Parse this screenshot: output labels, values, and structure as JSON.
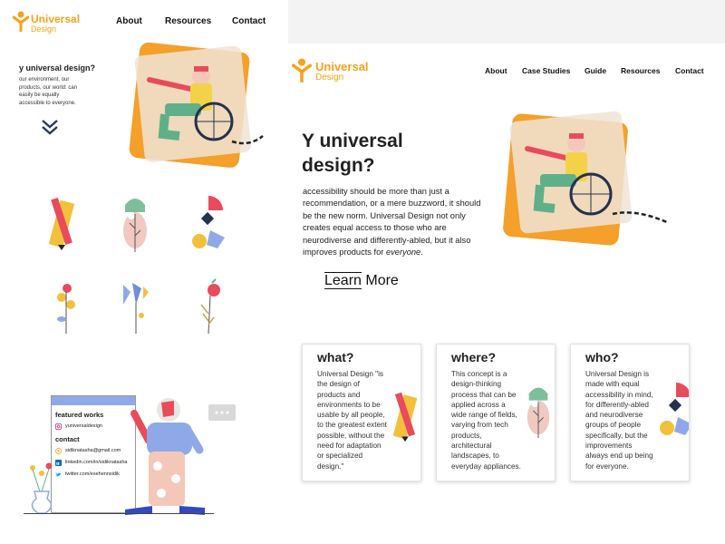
{
  "left": {
    "logo": {
      "title": "Universal",
      "subtitle": "Design"
    },
    "nav": [
      "About",
      "Resources",
      "Contact"
    ],
    "hero": {
      "title": "y universal design?",
      "body": [
        "our environment, our",
        "products, our world: can",
        "easily be equally",
        "accessible to everyone."
      ]
    },
    "footer": {
      "featured_title": "featured works",
      "instagram": "yuniversaldesign",
      "contact_title": "contact",
      "email": "sidiknatasha@gmail.com",
      "linkedin": "linkedin.com/in/sidiknatasha",
      "twitter": "twitter.com/esehennsidik"
    }
  },
  "right": {
    "logo": {
      "title": "Universal",
      "subtitle": "Design"
    },
    "nav": [
      "About",
      "Case Studies",
      "Guide",
      "Resources",
      "Contact"
    ],
    "hero": {
      "title_line1": "Y universal",
      "title_line2": "design?",
      "body_lines": [
        "accessibility should be more than just a",
        "recommendation, or a mere buzzword, it should",
        "be the new norm. Universal Design not only",
        "creates equal access to those who are",
        "neurodiverse and differently-abled, but it also"
      ],
      "body_last_prefix": "improves products for ",
      "body_last_em": "everyone",
      "body_last_suffix": ".",
      "cta_prefix": "Learn",
      "cta_suffix": " More"
    },
    "cards": [
      {
        "title": "what?",
        "lines": [
          "Universal Design \"is",
          "the design of",
          "products and",
          "environments to be",
          "usable by all people,",
          "to the greatest extent",
          "possible, without the",
          "need for adaptation",
          "or specialized",
          "design.\""
        ]
      },
      {
        "title": "where?",
        "lines": [
          "This concept is a",
          "design-thinking",
          "process that can be",
          "applied across a",
          "wide range of fields,",
          "varying from tech",
          "products,",
          "architectural",
          "landscapes, to",
          "everyday appliances."
        ]
      },
      {
        "title": "who?",
        "lines": [
          "Universal Design is",
          "made with equal",
          "accessibility in mind,",
          "for differently-abled",
          "and neurodiverse",
          "groups of people",
          "specifically, but the",
          "improvements",
          "always end up being",
          "for everyone."
        ]
      }
    ]
  },
  "colors": {
    "brand_orange": "#f7a21b",
    "hero_square": "#f4a02a",
    "hero_overlay": "#efe4d5"
  }
}
